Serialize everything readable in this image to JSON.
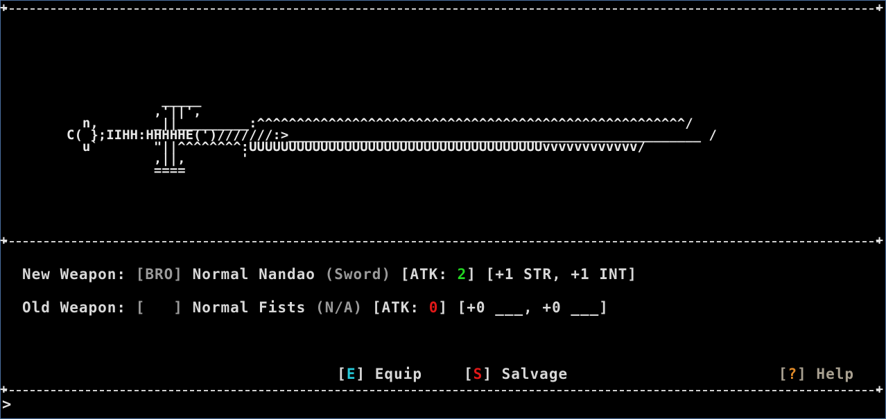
{
  "art": "            _____\n           ,'||',\n  n,       _||_________:^^^^^^^^^^^^^^^^^^^^^^^^^^^^^^^^^^^^^^^^^^^^^^^^^^^^^^/\nC( };IIHH:HHHHHE(')///////:>____________________________________________________ /\n  u`       \"||^^^^^^^^:UUUUUUUUUUUUUUUUUUUUUUUUUUUUUUUUUUUUUvvvvvvvvvvvv/\n           ,||,       '\n           ====",
  "new_weapon": {
    "label": "New Weapon: ",
    "tag": "[BRO]",
    "name": " Normal Nandao ",
    "type": "(Sword)",
    "atk_open": " [ATK: ",
    "atk_value": "2",
    "atk_close": "]",
    "bonuses": " [+1 STR, +1 INT]"
  },
  "old_weapon": {
    "label": "Old Weapon: ",
    "tag": "[   ]",
    "name": " Normal Fists ",
    "type": "(N/A)",
    "atk_open": " [ATK: ",
    "atk_value": "0",
    "atk_close": "]",
    "bonuses": " [+0 ___, +0 ___]"
  },
  "actions": {
    "equip": {
      "open": "[",
      "key": "E",
      "close": "]",
      "label": " Equip"
    },
    "salvage": {
      "open": "[",
      "key": "S",
      "close": "]",
      "label": " Salvage"
    }
  },
  "help": {
    "open": "[",
    "key": "?",
    "close": "]",
    "label": " Help"
  },
  "prompt": ">",
  "colors": {
    "atk_good": "#22d622",
    "atk_bad": "#e01818",
    "equip_key": "#25c8d8",
    "salvage_key": "#e01818",
    "help_key": "#e08a28"
  }
}
